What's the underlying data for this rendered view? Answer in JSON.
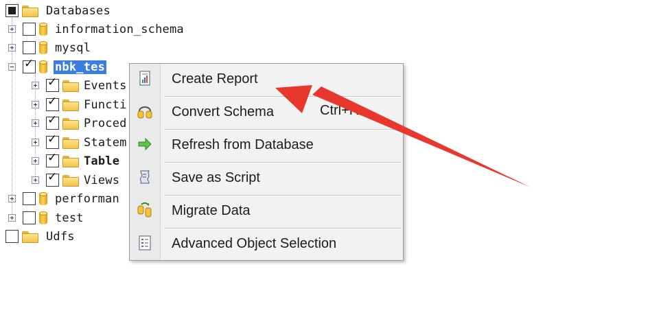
{
  "tree": {
    "root": {
      "label": "Databases"
    },
    "databases": [
      {
        "label": "information_schema",
        "checked": false
      },
      {
        "label": "mysql",
        "checked": false
      },
      {
        "label": "nbk_tes",
        "checked": true,
        "selected": true
      },
      {
        "label": "performan",
        "checked": false
      },
      {
        "label": "test",
        "checked": false
      }
    ],
    "children": [
      {
        "label": "Events"
      },
      {
        "label": "Functi"
      },
      {
        "label": "Proced"
      },
      {
        "label": "Statem"
      },
      {
        "label": "Table"
      },
      {
        "label": "Views"
      }
    ],
    "udfs": {
      "label": "Udfs"
    }
  },
  "context_menu": {
    "items": [
      {
        "label": "Create Report",
        "icon": "report-icon"
      },
      {
        "label": "Convert Schema",
        "icon": "convert-schema-icon",
        "shortcut": "Ctrl+R"
      },
      {
        "label": "Refresh from Database",
        "icon": "refresh-arrow-icon"
      },
      {
        "label": "Save as Script",
        "icon": "script-icon"
      },
      {
        "label": "Migrate Data",
        "icon": "migrate-data-icon"
      },
      {
        "label": "Advanced Object Selection",
        "icon": "object-selection-icon"
      }
    ]
  },
  "annotation": {
    "color": "#e8382e"
  }
}
